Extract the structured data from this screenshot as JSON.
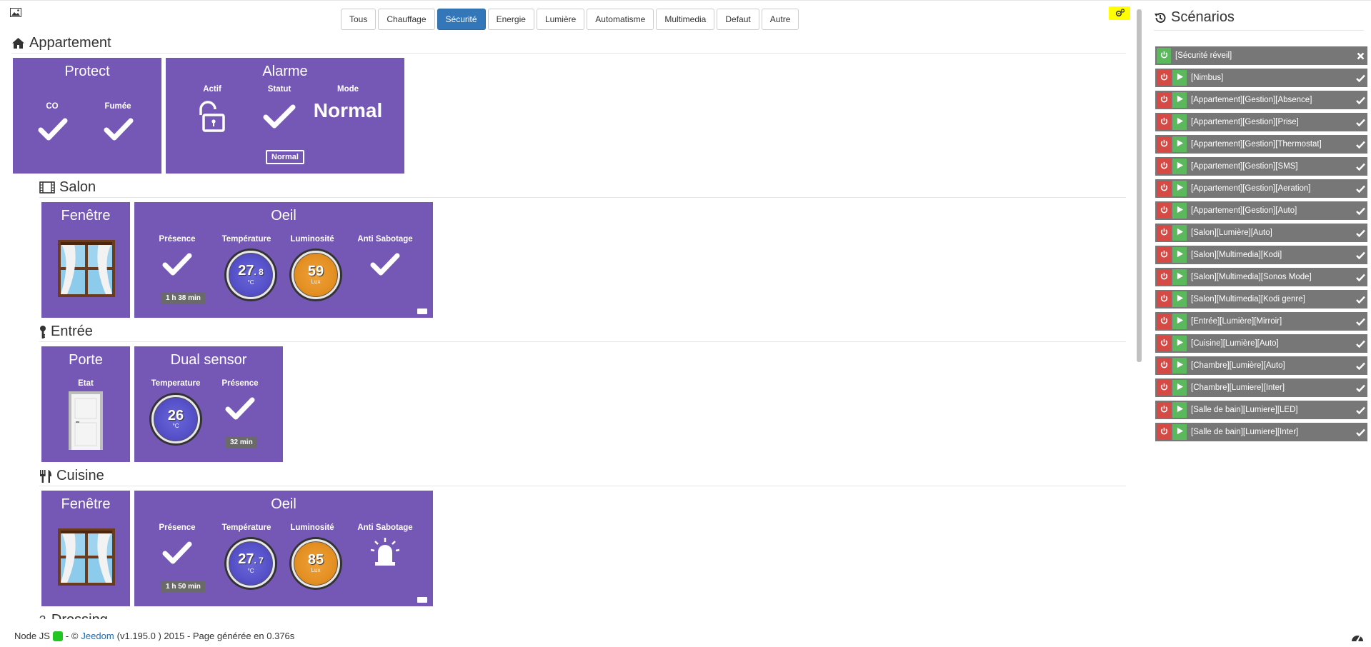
{
  "filters": [
    {
      "label": "Tous",
      "active": false
    },
    {
      "label": "Chauffage",
      "active": false
    },
    {
      "label": "Sécurité",
      "active": true
    },
    {
      "label": "Energie",
      "active": false
    },
    {
      "label": "Lumière",
      "active": false
    },
    {
      "label": "Automatisme",
      "active": false
    },
    {
      "label": "Multimedia",
      "active": false
    },
    {
      "label": "Defaut",
      "active": false
    },
    {
      "label": "Autre",
      "active": false
    }
  ],
  "objects": {
    "appartement": {
      "title": "Appartement",
      "protect": {
        "title": "Protect",
        "co_label": "CO",
        "fumee_label": "Fumée"
      },
      "alarme": {
        "title": "Alarme",
        "actif_label": "Actif",
        "statut_label": "Statut",
        "mode_label": "Mode",
        "mode_value": "Normal",
        "statut_button": "Normal"
      }
    },
    "salon": {
      "title": "Salon",
      "fenetre": {
        "title": "Fenêtre"
      },
      "oeil": {
        "title": "Oeil",
        "presence_label": "Présence",
        "presence_since": "1 h 38 min",
        "temp_label": "Température",
        "temp_int": "27",
        "temp_dec": ". 8",
        "temp_unit": "°C",
        "lum_label": "Luminosité",
        "lum_value": "59",
        "lum_unit": "Lux",
        "sab_label": "Anti Sabotage"
      }
    },
    "entree": {
      "title": "Entrée",
      "porte": {
        "title": "Porte",
        "etat_label": "Etat"
      },
      "dual": {
        "title": "Dual sensor",
        "temp_label": "Temperature",
        "temp_value": "26",
        "temp_unit": "°C",
        "presence_label": "Présence",
        "presence_since": "32 min"
      }
    },
    "cuisine": {
      "title": "Cuisine",
      "fenetre": {
        "title": "Fenêtre"
      },
      "oeil": {
        "title": "Oeil",
        "presence_label": "Présence",
        "presence_since": "1 h 50 min",
        "temp_label": "Température",
        "temp_int": "27",
        "temp_dec": ". 7",
        "temp_unit": "°C",
        "lum_label": "Luminosité",
        "lum_value": "85",
        "lum_unit": "Lux",
        "sab_label": "Anti Sabotage"
      }
    },
    "dressing": {
      "title": "Dressing"
    }
  },
  "scenarios": {
    "title": "Scénarios",
    "items": [
      {
        "name": "[Sécurité réveil]",
        "running": true,
        "active": false
      },
      {
        "name": "[Nimbus]",
        "running": false,
        "active": true
      },
      {
        "name": "[Appartement][Gestion][Absence]",
        "running": false,
        "active": true
      },
      {
        "name": "[Appartement][Gestion][Prise]",
        "running": false,
        "active": true
      },
      {
        "name": "[Appartement][Gestion][Thermostat]",
        "running": false,
        "active": true
      },
      {
        "name": "[Appartement][Gestion][SMS]",
        "running": false,
        "active": true
      },
      {
        "name": "[Appartement][Gestion][Aeration]",
        "running": false,
        "active": true
      },
      {
        "name": "[Appartement][Gestion][Auto]",
        "running": false,
        "active": true
      },
      {
        "name": "[Salon][Lumière][Auto]",
        "running": false,
        "active": true
      },
      {
        "name": "[Salon][Multimedia][Kodi]",
        "running": false,
        "active": true
      },
      {
        "name": "[Salon][Multimedia][Sonos Mode]",
        "running": false,
        "active": true
      },
      {
        "name": "[Salon][Multimedia][Kodi genre]",
        "running": false,
        "active": true
      },
      {
        "name": "[Entrée][Lumière][Mirroir]",
        "running": false,
        "active": true
      },
      {
        "name": "[Cuisine][Lumière][Auto]",
        "running": false,
        "active": true
      },
      {
        "name": "[Chambre][Lumière][Auto]",
        "running": false,
        "active": true
      },
      {
        "name": "[Chambre][Lumiere][Inter]",
        "running": false,
        "active": true
      },
      {
        "name": "[Salle de bain][Lumiere][LED]",
        "running": false,
        "active": true
      },
      {
        "name": "[Salle de bain][Lumiere][Inter]",
        "running": false,
        "active": true
      }
    ]
  },
  "footer": {
    "nodejs_label": "Node JS",
    "separator": "- ©",
    "brand": "Jeedom",
    "version": "(v1.195.0 ) 2015 - Page générée en 0.376s"
  },
  "colors": {
    "card": "#7558b5",
    "active_filter": "#3377b8",
    "scenario_row": "#777777",
    "stop": "#d64a45",
    "play": "#5cb85c",
    "nodejs_status": "#22c622"
  }
}
